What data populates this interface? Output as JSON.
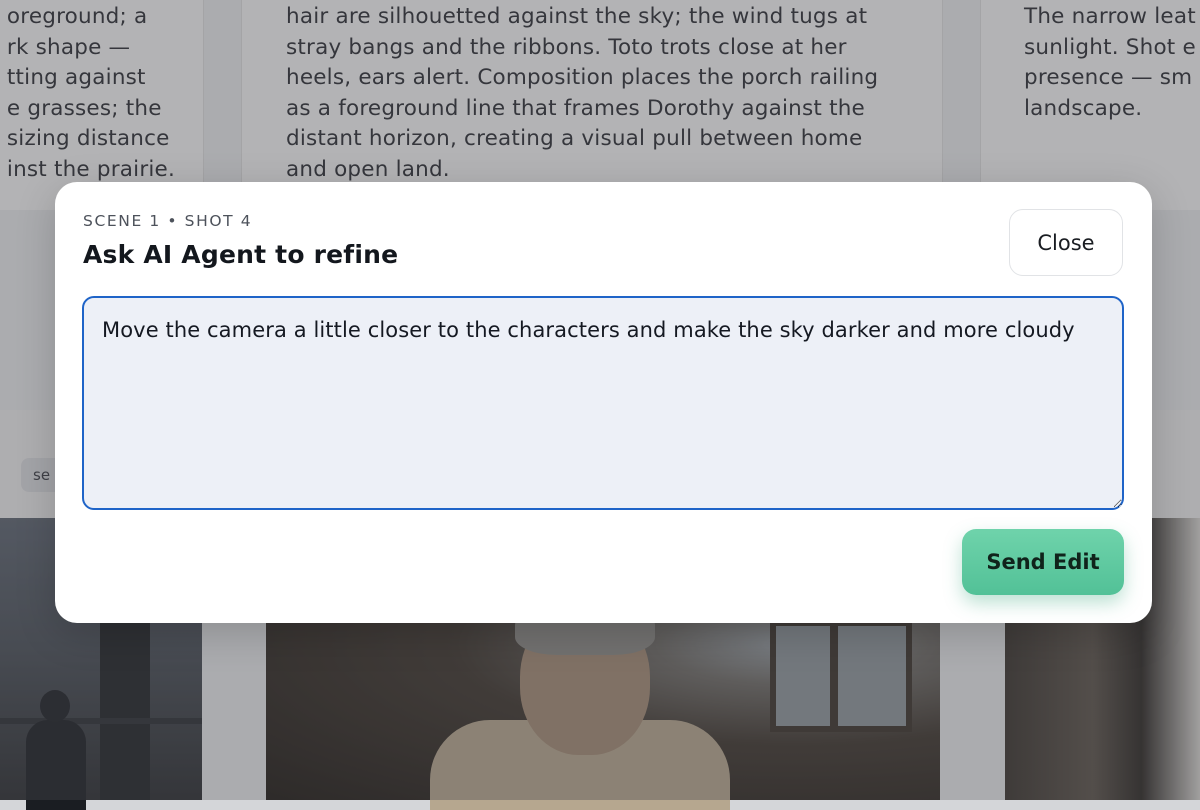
{
  "background": {
    "cards": [
      {
        "lines": [
          "oreground; a",
          "rk shape —",
          "tting against",
          "e grasses; the",
          "sizing distance",
          "inst the prairie."
        ]
      },
      {
        "lines": [
          "hair are silhouetted against the sky; the wind tugs at",
          "stray bangs and the ribbons. Toto trots close at her",
          "heels, ears alert. Composition places the porch railing",
          "as a foreground line that frames Dorothy against the",
          "distant horizon, creating a visual pull between home",
          "and open land."
        ]
      },
      {
        "lines": [
          "The narrow leat",
          "sunlight. Shot e",
          "presence — sm",
          "landscape."
        ]
      }
    ],
    "chip_label": "se"
  },
  "modal": {
    "eyebrow": "SCENE 1 • SHOT 4",
    "title": "Ask AI Agent to refine",
    "close_label": "Close",
    "prompt_value": "Move the camera a little closer to the characters and make the sky darker and more cloudy",
    "send_label": "Send Edit"
  }
}
